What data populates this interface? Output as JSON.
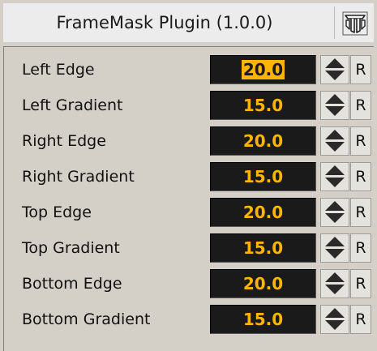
{
  "header": {
    "title": "FrameMask Plugin (1.0.0)",
    "icon": "plugin-info-icon"
  },
  "rows": [
    {
      "label": "Left Edge",
      "value": "20.0",
      "reset": "R",
      "focused": true
    },
    {
      "label": "Left Gradient",
      "value": "15.0",
      "reset": "R"
    },
    {
      "label": "Right Edge",
      "value": "20.0",
      "reset": "R"
    },
    {
      "label": "Right Gradient",
      "value": "15.0",
      "reset": "R"
    },
    {
      "label": "Top Edge",
      "value": "20.0",
      "reset": "R"
    },
    {
      "label": "Top Gradient",
      "value": "15.0",
      "reset": "R"
    },
    {
      "label": "Bottom Edge",
      "value": "20.0",
      "reset": "R"
    },
    {
      "label": "Bottom Gradient",
      "value": "15.0",
      "reset": "R"
    }
  ],
  "colors": {
    "panel_bg": "#d4d0c8",
    "header_bg": "#ececec",
    "field_bg": "#1a1a1a",
    "value_text": "#ffb400"
  }
}
